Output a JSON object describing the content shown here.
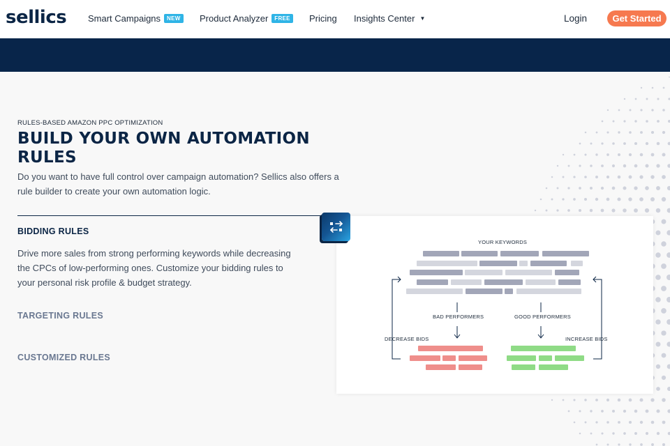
{
  "nav": {
    "logo": "sellics",
    "items": [
      {
        "label": "Smart Campaigns",
        "badge": "NEW"
      },
      {
        "label": "Product Analyzer",
        "badge": "FREE"
      },
      {
        "label": "Pricing"
      },
      {
        "label": "Insights Center",
        "has_dropdown": true
      }
    ],
    "login": "Login",
    "cta": "Get Started"
  },
  "hero": {
    "eyebrow": "RULES-BASED AMAZON PPC OPTIMIZATION",
    "headline": "BUILD YOUR OWN AUTOMATION RULES",
    "intro": "Do you want to have full control over campaign automation? Sellics also offers a rule builder to create your own automation logic."
  },
  "rules": [
    {
      "title": "BIDDING RULES",
      "active": true,
      "description": "Drive more sales from strong performing keywords while decreasing the CPCs of low-performing ones. Customize your bidding rules to your personal risk profile & budget strategy."
    },
    {
      "title": "TARGETING RULES",
      "active": false
    },
    {
      "title": "CUSTOMIZED RULES",
      "active": false
    }
  ],
  "diagram": {
    "title": "YOUR KEYWORDS",
    "bad_label": "BAD PERFORMERS",
    "good_label": "GOOD PERFORMERS",
    "decrease_label": "DECREASE BIDS",
    "increase_label": "INCREASE BIDS"
  },
  "colors": {
    "brand_navy": "#0b2545",
    "band": "#08254a",
    "cta": "#f6794f",
    "badge": "#2fb4e6",
    "bad_bars": "#ef8e8b",
    "good_bars": "#8fdb86",
    "keyword_dark": "#a2a6b8",
    "keyword_light": "#d4d6de"
  },
  "icons": {
    "card_icon": "swap-arrows-icon",
    "dropdown": "caret-down-icon"
  }
}
